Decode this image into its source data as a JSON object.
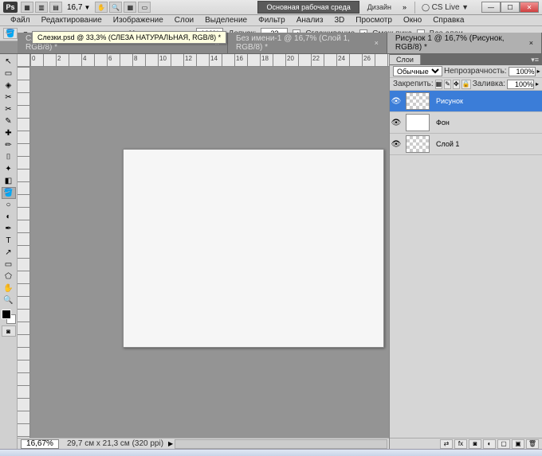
{
  "titlebar": {
    "logo": "Ps",
    "zoom": "16,7",
    "workspace_main": "Основная рабочая среда",
    "workspace_design": "Дизайн",
    "cslive": "CS Live"
  },
  "menu": [
    "Файл",
    "Редактирование",
    "Изображение",
    "Слои",
    "Выделение",
    "Фильтр",
    "Анализ",
    "3D",
    "Просмотр",
    "Окно",
    "Справка"
  ],
  "options": {
    "opacity_label": "Непрозрачность:",
    "opacity_value": "100%",
    "tolerance_label": "Допуск:",
    "tolerance_value": "32",
    "antialias_label": "Сглаживание",
    "contiguous_label": "Смеж.пикс",
    "all_layers_label": "Все слои",
    "antialias_checked": "✓",
    "contiguous_checked": "✓"
  },
  "tooltip": "Слезки.psd @ 33,3% (СЛЕЗА НАТУРАЛЬНАЯ, RGB/8) *",
  "tabs": [
    {
      "label": "Слезки.psd @ 33,3% (СЛЕЗА НАТУРАЛЬНАЯ, RGB/8) *",
      "active": false
    },
    {
      "label": "Без имени-1 @ 16,7% (Слой 1, RGB/8) *",
      "active": false
    },
    {
      "label": "Рисунок 1 @ 16,7% (Рисунок, RGB/8) *",
      "active": true
    }
  ],
  "tools": [
    "↖",
    "▭",
    "◈",
    "✂",
    "✎",
    "✦",
    "✚",
    "●",
    "⌷",
    "▧",
    "◐",
    "✏",
    "⬚",
    "⊿",
    "◧",
    "⍉",
    "⌕",
    "T",
    "↗",
    "⬠",
    "✋",
    "🔍",
    "⋯"
  ],
  "layers_panel": {
    "tab": "Слои",
    "blend_mode": "Обычные",
    "opacity_label": "Непрозрачность:",
    "opacity_value": "100%",
    "lock_label": "Закрепить:",
    "fill_label": "Заливка:",
    "fill_value": "100%",
    "layers": [
      {
        "name": "Рисунок",
        "selected": true,
        "checker": true,
        "visible": "👁"
      },
      {
        "name": "Фон",
        "selected": false,
        "checker": false,
        "visible": "👁"
      },
      {
        "name": "Слой 1",
        "selected": false,
        "checker": true,
        "visible": "👁"
      }
    ]
  },
  "status": {
    "zoom": "16,67%",
    "dims": "29,7 см x 21,3 см (320 ppi)"
  }
}
